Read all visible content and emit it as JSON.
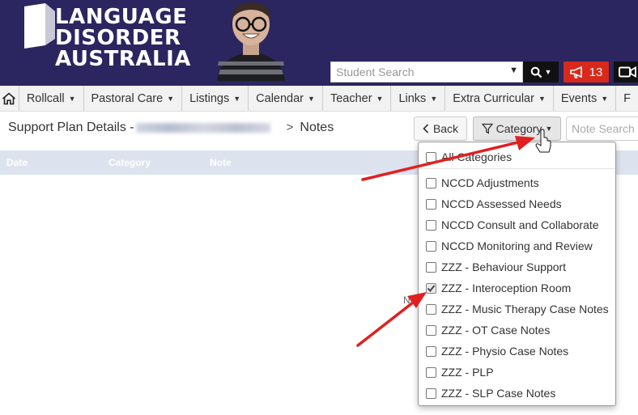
{
  "brand": {
    "logo_lines": [
      "LANGUAGE",
      "DISORDER",
      "AUSTRALIA"
    ]
  },
  "header": {
    "search_placeholder": "Student Search",
    "alert_count": "13"
  },
  "nav": {
    "items": [
      {
        "label": "Rollcall"
      },
      {
        "label": "Pastoral Care"
      },
      {
        "label": "Listings"
      },
      {
        "label": "Calendar"
      },
      {
        "label": "Teacher"
      },
      {
        "label": "Links"
      },
      {
        "label": "Extra Curricular"
      },
      {
        "label": "Events"
      },
      {
        "label": "F"
      }
    ]
  },
  "page": {
    "title": "Support Plan Details -",
    "section": "Notes",
    "back_label": "Back",
    "category_label": "Category",
    "note_search_placeholder": "Note Search"
  },
  "table": {
    "columns": [
      "Date",
      "Category",
      "Note"
    ],
    "stray_text": "N"
  },
  "dropdown": {
    "all_label": "All Categories",
    "all_checked": false,
    "items": [
      {
        "label": "NCCD Adjustments",
        "checked": false
      },
      {
        "label": "NCCD Assessed Needs",
        "checked": false
      },
      {
        "label": "NCCD Consult and Collaborate",
        "checked": false
      },
      {
        "label": "NCCD Monitoring and Review",
        "checked": false
      },
      {
        "label": "ZZZ - Behaviour Support",
        "checked": false
      },
      {
        "label": "ZZZ - Interoception Room",
        "checked": true
      },
      {
        "label": "ZZZ - Music Therapy Case Notes",
        "checked": false
      },
      {
        "label": "ZZZ - OT Case Notes",
        "checked": false
      },
      {
        "label": "ZZZ - Physio Case Notes",
        "checked": false
      },
      {
        "label": "ZZZ - PLP",
        "checked": false
      },
      {
        "label": "ZZZ - SLP Case Notes",
        "checked": false
      }
    ]
  },
  "colors": {
    "header_bg": "#2b2660",
    "alert_red": "#d9281c",
    "annotation_arrow": "#e02020",
    "table_header_bg": "#dde3ee"
  },
  "icons": [
    "home-icon",
    "search-icon",
    "megaphone-icon",
    "video-icon",
    "filter-icon",
    "chevron-left-icon",
    "cursor-hand-icon"
  ]
}
